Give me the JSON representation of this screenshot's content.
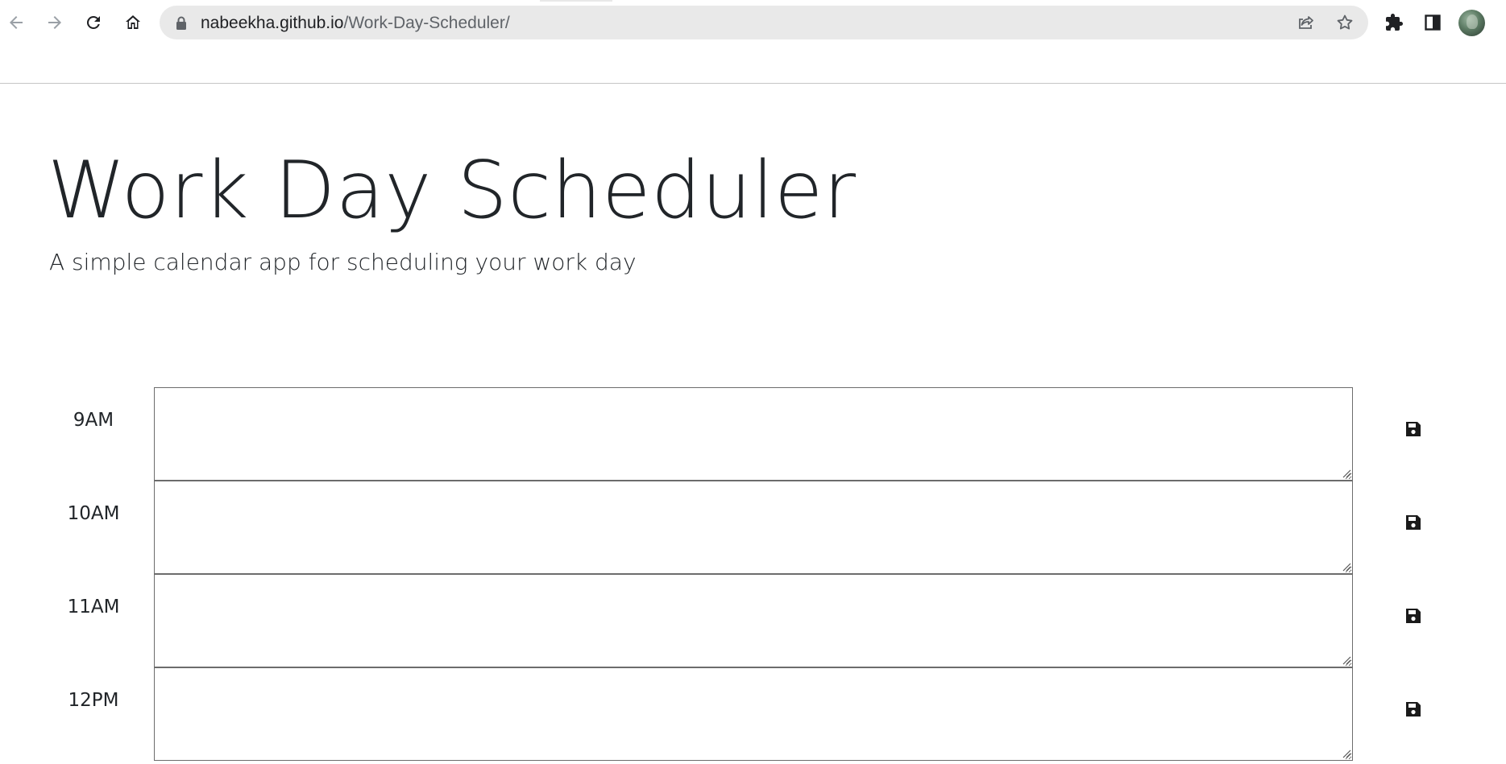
{
  "browser": {
    "url_host": "nabeekha.github.io",
    "url_path": "/Work-Day-Scheduler/",
    "nav": {
      "back_icon": "arrow-left-icon",
      "forward_icon": "arrow-right-icon",
      "reload_icon": "reload-icon",
      "home_icon": "home-icon"
    },
    "omnibox_icons": [
      "lock-icon",
      "share-icon",
      "star-icon"
    ],
    "toolbar_icons": [
      "extensions-icon",
      "side-panel-icon",
      "profile-avatar"
    ]
  },
  "header": {
    "title": "Work Day Scheduler",
    "subtitle": "A simple calendar app for scheduling your work day"
  },
  "schedule": {
    "blocks": [
      {
        "hour": "9AM",
        "text": ""
      },
      {
        "hour": "10AM",
        "text": ""
      },
      {
        "hour": "11AM",
        "text": ""
      },
      {
        "hour": "12PM",
        "text": ""
      }
    ],
    "save_icon": "floppy-disk-icon"
  },
  "colors": {
    "text": "#212529",
    "textarea_border": "#6c6c6c",
    "omnibox_bg": "#e9e9e9"
  }
}
